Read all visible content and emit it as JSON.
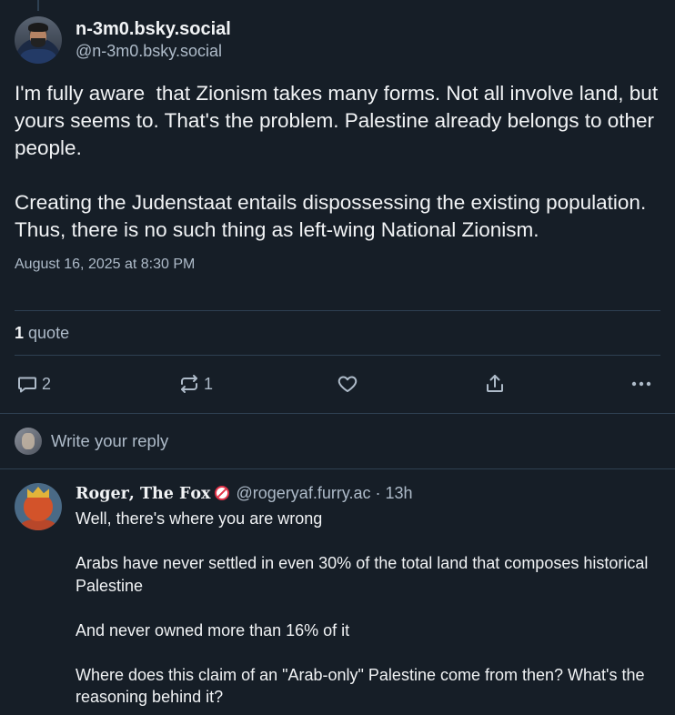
{
  "main_post": {
    "display_name": "n-3m0.bsky.social",
    "handle": "@n-3m0.bsky.social",
    "text": "I'm fully aware  that Zionism takes many forms. Not all involve land, but yours seems to. That's the problem. Palestine already belongs to other people.\n\nCreating the Judenstaat entails dispossessing the existing population. Thus, there is no such thing as left-wing National Zionism.",
    "timestamp": "August 16, 2025 at 8:30 PM",
    "quote_count": "1",
    "quote_label": "quote",
    "actions": {
      "reply_count": "2",
      "repost_count": "1"
    }
  },
  "reply_box": {
    "placeholder": "Write your reply"
  },
  "reply_post": {
    "display_name": "𝐑𝐨𝐠𝐞𝐫, 𝐓𝐡𝐞 𝐅𝐨𝐱",
    "handle_time": "@rogeryaf.furry.ac · 13h",
    "text": "Well, there's where you are wrong\n\nArabs have never settled in even 30% of the total land that composes historical Palestine\n\nAnd never owned more than 16% of it\n\nWhere does this claim of an \"Arab-only\" Palestine come from then? What's the reasoning behind it?"
  },
  "icons": {
    "reply": "speech-bubble-icon",
    "repost": "repost-arrows-icon",
    "like": "heart-icon",
    "share": "share-upload-icon",
    "more": "more-dots-icon",
    "badge": "no-entry-icon"
  },
  "colors": {
    "background": "#161e27",
    "text": "#f1f3f5",
    "muted": "#aebbc9",
    "divider": "#2e4052"
  }
}
